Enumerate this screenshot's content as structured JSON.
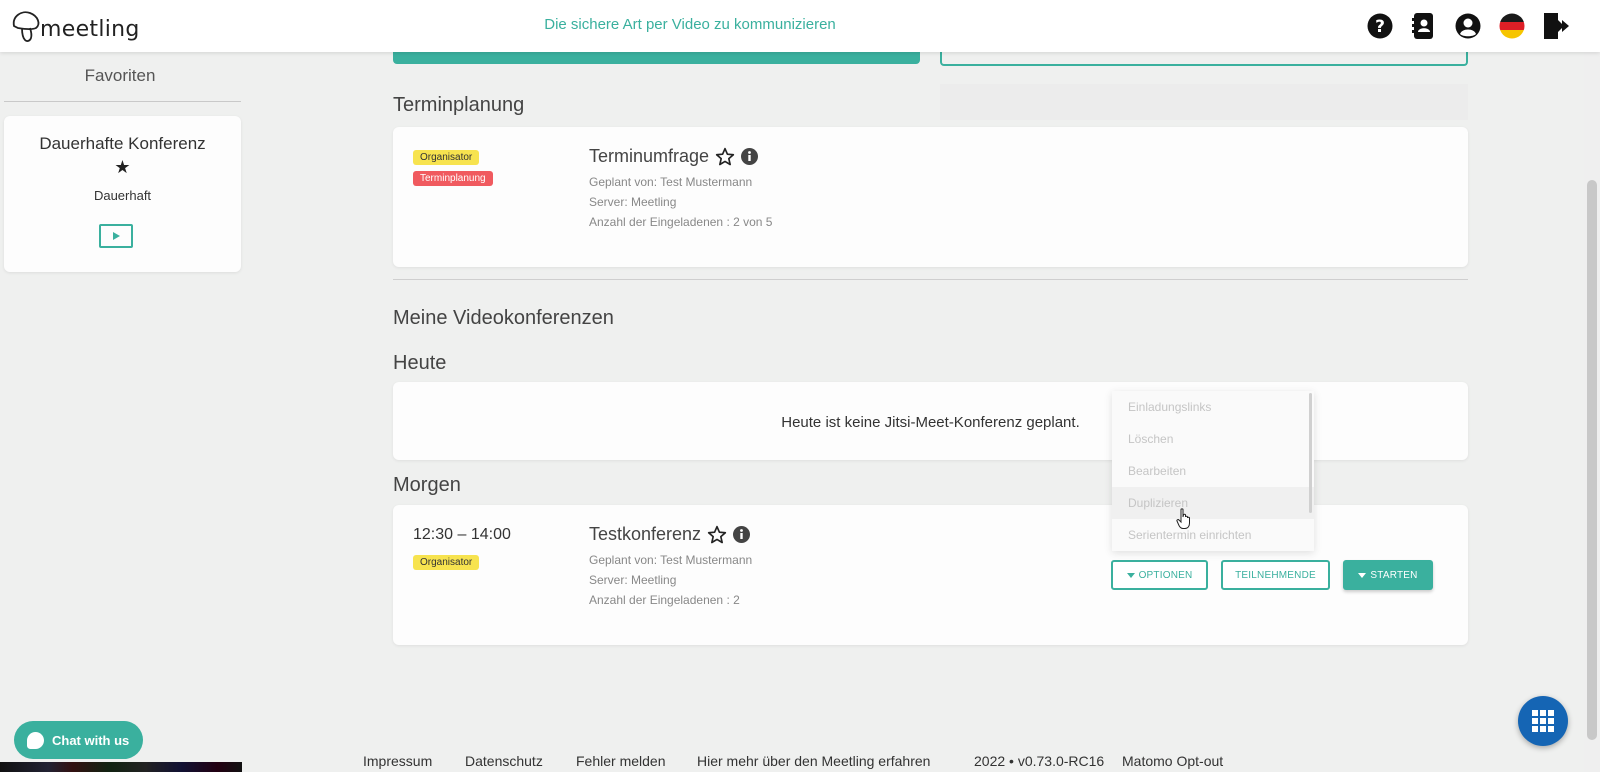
{
  "header": {
    "logo_text": "meetling",
    "tagline": "Die sichere Art per Video zu kommunizieren",
    "icons": [
      "help-icon",
      "contacts-icon",
      "account-icon",
      "german-flag-icon",
      "logout-icon"
    ]
  },
  "favorites": {
    "title": "Favoriten",
    "card": {
      "title": "Dauerhafte Konferenz",
      "star": "★",
      "subtitle": "Dauerhaft",
      "play_icon": "play-icon"
    }
  },
  "scheduling": {
    "heading": "Terminplanung",
    "item": {
      "badges": [
        "Organisator",
        "Terminplanung"
      ],
      "title": "Terminumfrage",
      "planned_by": "Geplant von: Test Mustermann",
      "server": "Server: Meetling",
      "invited": "Anzahl der Eingeladenen : 2 von 5"
    }
  },
  "conferences": {
    "heading": "Meine Videokonferenzen",
    "today": {
      "heading": "Heute",
      "empty": "Heute ist keine Jitsi-Meet-Konferenz geplant."
    },
    "tomorrow": {
      "heading": "Morgen",
      "item": {
        "time": "12:30 – 14:00",
        "badge": "Organisator",
        "title": "Testkonferenz",
        "planned_by": "Geplant von: Test Mustermann",
        "server": "Server: Meetling",
        "invited": "Anzahl der Eingeladenen : 2",
        "buttons": {
          "options": "OPTIONEN",
          "participants": "TEILNEHMENDE",
          "start": "STARTEN"
        }
      }
    }
  },
  "dropdown": {
    "items": [
      "Einladungslinks",
      "Löschen",
      "Bearbeiten",
      "Duplizieren",
      "Serientermin einrichten"
    ]
  },
  "chat": {
    "label": "Chat with us"
  },
  "footer": {
    "links": [
      "Impressum",
      "Datenschutz",
      "Fehler melden",
      "Hier mehr über den Meetling erfahren",
      "2022 • v0.73.0-RC16",
      "Matomo Opt-out"
    ]
  },
  "colors": {
    "accent": "#3ab09e",
    "badge_yellow": "#f7e34f",
    "badge_red": "#f05a5f",
    "apps_blue": "#1565b4"
  }
}
